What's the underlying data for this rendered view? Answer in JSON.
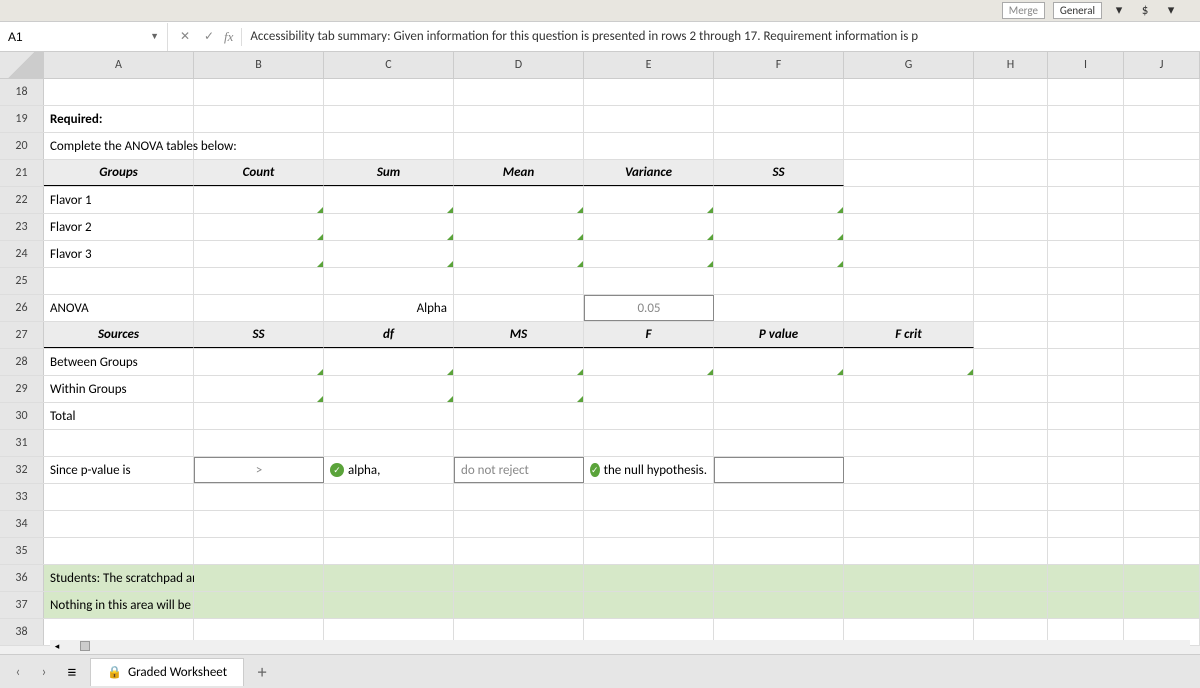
{
  "toolbarTop": {
    "merge": "Merge",
    "general": "General",
    "currency": "$"
  },
  "nameBox": "A1",
  "fxLabel": "fx",
  "formula": "Accessibility tab summary: Given information for this question is presented in rows 2 through 17. Requirement information is p",
  "columns": [
    "A",
    "B",
    "C",
    "D",
    "E",
    "F",
    "G",
    "H",
    "I",
    "J"
  ],
  "rowStart": 18,
  "rowEnd": 38,
  "cells": {
    "A19": "Required:",
    "A20": "Complete the ANOVA tables below:",
    "A21": "Groups",
    "B21": "Count",
    "C21": "Sum",
    "D21": "Mean",
    "E21": "Variance",
    "F21": "SS",
    "A22": "Flavor 1",
    "A23": "Flavor 2",
    "A24": "Flavor 3",
    "A26": "ANOVA",
    "C26_label": "Alpha",
    "D26_value": "0.05",
    "A27": "Sources",
    "B27": "SS",
    "C27": "df",
    "D27": "MS",
    "E27": "F",
    "F27": "P value",
    "G27": "F crit",
    "A28": "Between Groups",
    "A29": "Within Groups",
    "A30": "Total",
    "A32": "Since p-value is",
    "B32": ">",
    "C32_check": "alpha,",
    "D32_do": "do not reject",
    "E32_check": "the null hypothesis.",
    "A36": "Students: The scratchpad area is for you to do any additional work you need to solve this question or can be used to show your work.",
    "A37": "Nothing in this area will be graded, but it will be submitted with your assignment."
  },
  "sheetTab": {
    "name": "Graded Worksheet"
  }
}
